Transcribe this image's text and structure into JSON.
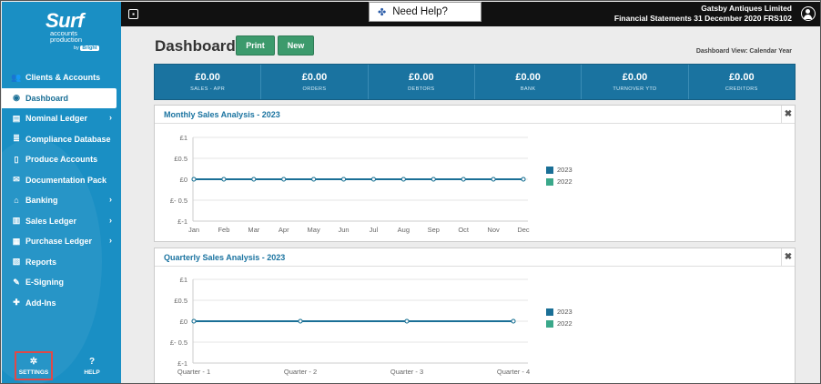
{
  "brand": {
    "name": "Surf",
    "tagline_1": "accounts",
    "tagline_2": "production",
    "by": "by",
    "by_brand": "Bright"
  },
  "sidebar": {
    "items": [
      {
        "label": "Clients & Accounts",
        "icon": "users-icon",
        "glyph": "👥",
        "chevron": false,
        "active": false
      },
      {
        "label": "Dashboard",
        "icon": "dashboard-icon",
        "glyph": "◉",
        "chevron": false,
        "active": true
      },
      {
        "label": "Nominal Ledger",
        "icon": "ledger-icon",
        "glyph": "▤",
        "chevron": true,
        "active": false
      },
      {
        "label": "Compliance Database",
        "icon": "database-icon",
        "glyph": "≣",
        "chevron": false,
        "active": false
      },
      {
        "label": "Produce Accounts",
        "icon": "file-icon",
        "glyph": "▯",
        "chevron": false,
        "active": false
      },
      {
        "label": "Documentation Pack",
        "icon": "envelope-icon",
        "glyph": "✉",
        "chevron": false,
        "active": false
      },
      {
        "label": "Banking",
        "icon": "bank-icon",
        "glyph": "⌂",
        "chevron": true,
        "active": false
      },
      {
        "label": "Sales Ledger",
        "icon": "sales-ledger-icon",
        "glyph": "▥",
        "chevron": true,
        "active": false
      },
      {
        "label": "Purchase Ledger",
        "icon": "purchase-ledger-icon",
        "glyph": "▦",
        "chevron": true,
        "active": false
      },
      {
        "label": "Reports",
        "icon": "reports-icon",
        "glyph": "▧",
        "chevron": false,
        "active": false
      },
      {
        "label": "E-Signing",
        "icon": "edit-icon",
        "glyph": "✎",
        "chevron": false,
        "active": false
      },
      {
        "label": "Add-Ins",
        "icon": "puzzle-icon",
        "glyph": "✚",
        "chevron": false,
        "active": false
      }
    ],
    "settings_label": "SETTINGS",
    "help_label": "HELP"
  },
  "topbar": {
    "need_help": "Need Help?",
    "company": "Gatsby Antiques Limited",
    "subtitle": "Financial Statements 31 December 2020 FRS102"
  },
  "page": {
    "title": "Dashboard",
    "print_label": "Print",
    "new_label": "New",
    "view_label": "Dashboard View: Calendar Year"
  },
  "stats": [
    {
      "value": "£0.00",
      "label": "SALES - APR"
    },
    {
      "value": "£0.00",
      "label": "ORDERS"
    },
    {
      "value": "£0.00",
      "label": "DEBTORS"
    },
    {
      "value": "£0.00",
      "label": "BANK"
    },
    {
      "value": "£0.00",
      "label": "TURNOVER YTD"
    },
    {
      "value": "£0.00",
      "label": "CREDITORS"
    }
  ],
  "panels": {
    "monthly_title": "Monthly Sales Analysis - 2023",
    "quarterly_title": "Quarterly Sales Analysis - 2023",
    "close_glyph": "✖"
  },
  "colors": {
    "series_2023": "#1a6f96",
    "series_2022": "#3aa88a",
    "accent": "#1a8fc4"
  },
  "chart_data": [
    {
      "type": "line",
      "title": "Monthly Sales Analysis - 2023",
      "categories": [
        "Jan",
        "Feb",
        "Mar",
        "Apr",
        "May",
        "Jun",
        "Jul",
        "Aug",
        "Sep",
        "Oct",
        "Nov",
        "Dec"
      ],
      "yticks": [
        "£1",
        "£0.5",
        "£0",
        "£- 0.5",
        "£-1"
      ],
      "ylim": [
        -1,
        1
      ],
      "series": [
        {
          "name": "2023",
          "values": [
            0,
            0,
            0,
            0,
            0,
            0,
            0,
            0,
            0,
            0,
            0,
            0
          ]
        },
        {
          "name": "2022",
          "values": [
            0,
            0,
            0,
            0,
            0,
            0,
            0,
            0,
            0,
            0,
            0,
            0
          ]
        }
      ],
      "legend": "right"
    },
    {
      "type": "line",
      "title": "Quarterly Sales Analysis - 2023",
      "categories": [
        "Quarter - 1",
        "Quarter - 2",
        "Quarter - 3",
        "Quarter - 4"
      ],
      "yticks": [
        "£1",
        "£0.5",
        "£0",
        "£- 0.5",
        "£-1"
      ],
      "ylim": [
        -1,
        1
      ],
      "series": [
        {
          "name": "2023",
          "values": [
            0,
            0,
            0,
            0
          ]
        },
        {
          "name": "2022",
          "values": [
            0,
            0,
            0,
            0
          ]
        }
      ],
      "legend": "right"
    }
  ]
}
